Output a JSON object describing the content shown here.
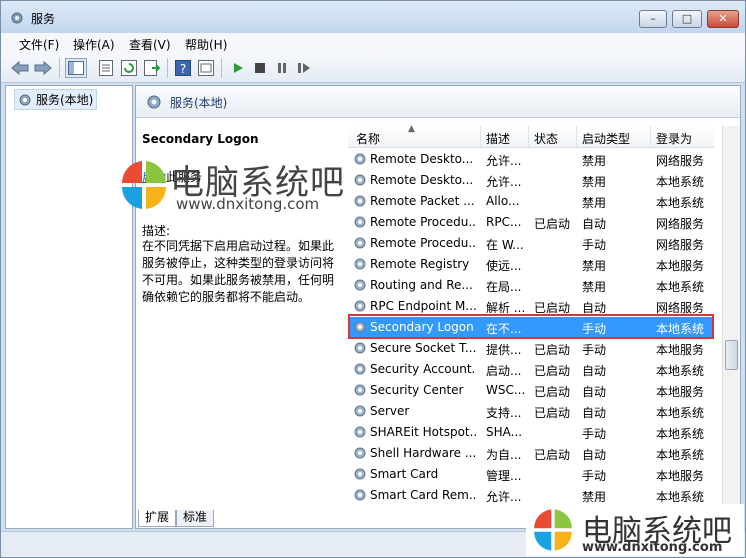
{
  "window": {
    "title": "服务",
    "min": "–",
    "max": "□",
    "close": "✕"
  },
  "menu": [
    "文件(F)",
    "操作(A)",
    "查看(V)",
    "帮助(H)"
  ],
  "tree": {
    "root_label": "服务(本地)"
  },
  "main": {
    "header_title": "服务(本地)"
  },
  "description": {
    "service_name": "Secondary Logon",
    "start_link": "启动",
    "start_suffix": "此服务",
    "label": "描述:",
    "text": "在不同凭据下启用启动过程。如果此服务被停止，这种类型的登录访问将不可用。如果此服务被禁用，任何明确依赖它的服务都将不能启动。"
  },
  "columns": [
    "名称",
    "描述",
    "状态",
    "启动类型",
    "登录为"
  ],
  "rows": [
    {
      "name": "Remote Deskto...",
      "desc": "允许...",
      "status": "",
      "startup": "禁用",
      "logon": "网络服务"
    },
    {
      "name": "Remote Deskto...",
      "desc": "允许...",
      "status": "",
      "startup": "禁用",
      "logon": "本地系统"
    },
    {
      "name": "Remote Packet ...",
      "desc": "Allo...",
      "status": "",
      "startup": "禁用",
      "logon": "本地系统"
    },
    {
      "name": "Remote Procedu...",
      "desc": "RPC...",
      "status": "已启动",
      "startup": "自动",
      "logon": "网络服务"
    },
    {
      "name": "Remote Procedu...",
      "desc": "在 W...",
      "status": "",
      "startup": "手动",
      "logon": "网络服务"
    },
    {
      "name": "Remote Registry",
      "desc": "使远...",
      "status": "",
      "startup": "禁用",
      "logon": "本地服务"
    },
    {
      "name": "Routing and Re...",
      "desc": "在局...",
      "status": "",
      "startup": "禁用",
      "logon": "本地系统"
    },
    {
      "name": "RPC Endpoint M...",
      "desc": "解析 ...",
      "status": "已启动",
      "startup": "自动",
      "logon": "网络服务"
    },
    {
      "name": "Secondary Logon",
      "desc": "在不...",
      "status": "",
      "startup": "手动",
      "logon": "本地系统"
    },
    {
      "name": "Secure Socket T...",
      "desc": "提供...",
      "status": "已启动",
      "startup": "手动",
      "logon": "本地服务"
    },
    {
      "name": "Security Account...",
      "desc": "启动...",
      "status": "已启动",
      "startup": "自动",
      "logon": "本地系统"
    },
    {
      "name": "Security Center",
      "desc": "WSC...",
      "status": "已启动",
      "startup": "自动",
      "logon": "本地服务"
    },
    {
      "name": "Server",
      "desc": "支持...",
      "status": "已启动",
      "startup": "自动",
      "logon": "本地系统"
    },
    {
      "name": "SHAREit Hotspot...",
      "desc": "SHA...",
      "status": "",
      "startup": "手动",
      "logon": "本地系统"
    },
    {
      "name": "Shell Hardware ...",
      "desc": "为自...",
      "status": "已启动",
      "startup": "自动",
      "logon": "本地系统"
    },
    {
      "name": "Smart Card",
      "desc": "管理...",
      "status": "",
      "startup": "手动",
      "logon": "本地服务"
    },
    {
      "name": "Smart Card Rem...",
      "desc": "允许...",
      "status": "",
      "startup": "禁用",
      "logon": "本地系统"
    }
  ],
  "selected_row": "Secondary Logon",
  "tabs": [
    "扩展",
    "标准"
  ],
  "watermark": {
    "cn": "电脑系统吧",
    "url": "www.dnxitong.com"
  },
  "colors": {
    "selection": "#3399ff",
    "highlight_border": "#d9343a",
    "link": "#0563c1"
  }
}
